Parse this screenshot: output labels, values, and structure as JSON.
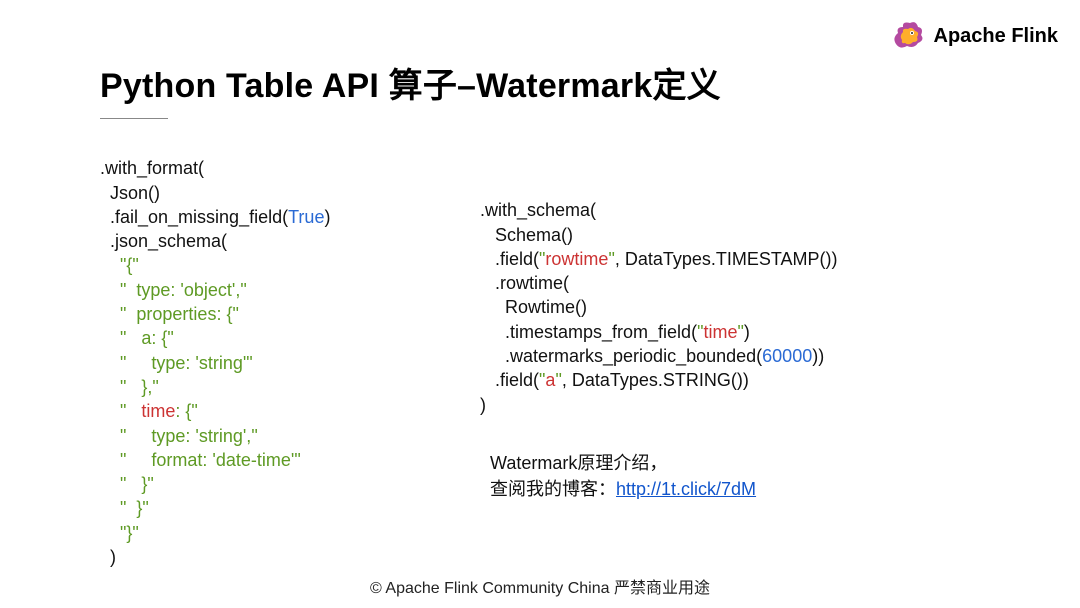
{
  "brand": {
    "text": "Apache Flink"
  },
  "title": "Python Table API 算子–Watermark定义",
  "code_left": {
    "l0": ".with_format(",
    "l1": "  Json()",
    "l2_a": "  .fail_on_missing_field(",
    "l2_true": "True",
    "l2_b": ")",
    "l3": "  .json_schema(",
    "l4": "    \"{\"",
    "l5": "    \"  type: 'object',\"",
    "l6": "    \"  properties: {\"",
    "l7": "    \"   a: {\"",
    "l8": "    \"     type: 'string'\"",
    "l9": "    \"   },\"",
    "l10_a": "    \"   ",
    "l10_time": "time",
    "l10_b": ": {\"",
    "l11": "    \"     type: 'string',\"",
    "l12": "    \"     format: 'date-time'\"",
    "l13": "    \"   }\"",
    "l14": "    \"  }\"",
    "l15": "    \"}\"",
    "l16": "  )"
  },
  "code_right": {
    "l0": ".with_schema(",
    "l1": "   Schema()",
    "l2_a": "   .field(",
    "l2_q1": "\"",
    "l2_rowtime": "rowtime",
    "l2_q2": "\"",
    "l2_b": ", DataTypes.TIMESTAMP())",
    "l3": "   .rowtime(",
    "l4": "     Rowtime()",
    "l5_a": "     .timestamps_from_field(",
    "l5_q1": "\"",
    "l5_time": "time",
    "l5_q2": "\"",
    "l5_b": ")",
    "l6_a": "     .watermarks_periodic_bounded(",
    "l6_num": "60000",
    "l6_b": "))",
    "l7_a": "   .field(",
    "l7_q1": "\"",
    "l7_a_field": "a",
    "l7_q2": "\"",
    "l7_b": ", DataTypes.STRING())",
    "l8": ")"
  },
  "note": {
    "line1": "Watermark原理介绍，",
    "line2_prefix": "查阅我的博客：",
    "link_text": "http://1t.click/7dM",
    "link_href": "http://1t.click/7dM"
  },
  "footer": "© Apache Flink Community China  严禁商业用途"
}
